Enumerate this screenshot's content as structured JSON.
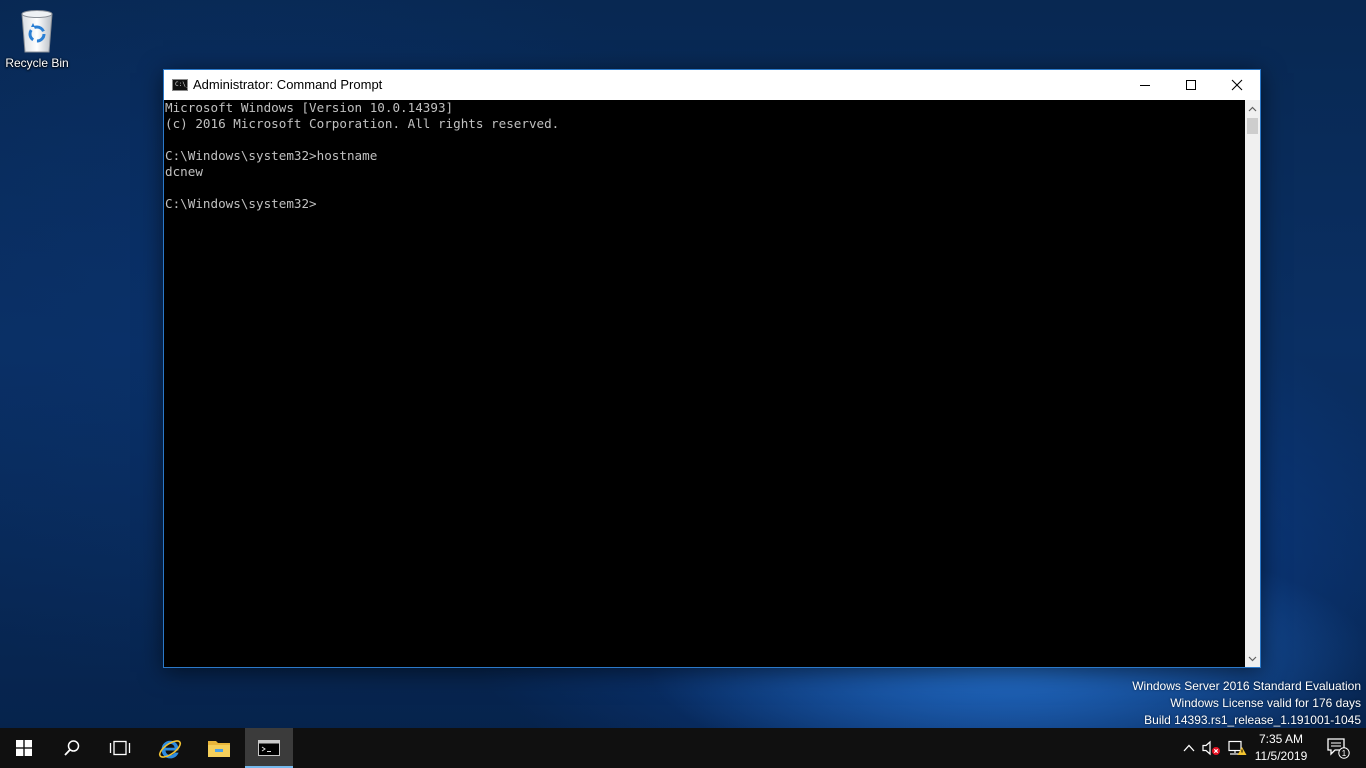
{
  "desktop": {
    "recycle_bin_label": "Recycle Bin"
  },
  "window": {
    "title": "Administrator: Command Prompt",
    "icon": "cmd-icon",
    "icon_text": "C:\\_"
  },
  "console": {
    "lines": [
      "Microsoft Windows [Version 10.0.14393]",
      "(c) 2016 Microsoft Corporation. All rights reserved.",
      "",
      "C:\\Windows\\system32>hostname",
      "dcnew",
      "",
      "C:\\Windows\\system32>"
    ]
  },
  "watermark": {
    "line1": "Windows Server 2016 Standard Evaluation",
    "line2": "Windows License valid for 176 days",
    "line3": "Build 14393.rs1_release_1.191001-1045"
  },
  "taskbar": {
    "icons": [
      "windows-start-icon",
      "search-icon",
      "task-view-icon",
      "internet-explorer-icon",
      "file-explorer-icon",
      "cmd-icon"
    ],
    "clock_time": "7:35 AM",
    "clock_date": "11/5/2019",
    "notification_count": "1"
  },
  "colors": {
    "console_bg": "#000000",
    "console_fg": "#c0c0c0",
    "taskbar_bg": "#101010",
    "accent": "#76b9ed"
  }
}
